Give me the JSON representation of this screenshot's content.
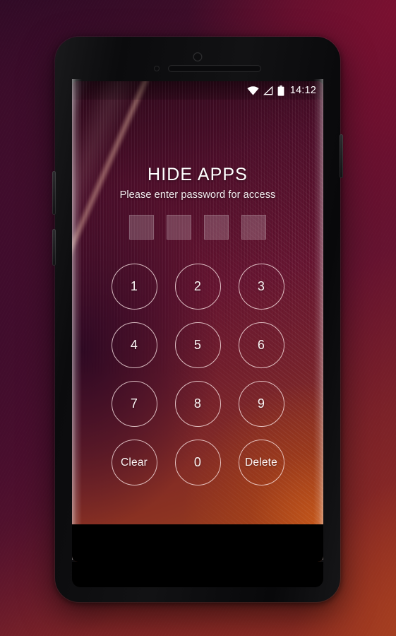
{
  "device": {
    "name": "android-smartphone-mockup",
    "hardware": {
      "front_camera": "camera-icon",
      "proximity_sensor": "sensor-icon",
      "earpiece": "speaker-grille-icon",
      "buttons": [
        "volume-button",
        "bixby-button",
        "power-button"
      ]
    }
  },
  "statusbar": {
    "wifi_icon": "wifi-icon",
    "signal_icon": "signal-triangle-icon",
    "battery_icon": "battery-full-icon",
    "time": "14:12"
  },
  "lockscreen": {
    "title": "HIDE APPS",
    "subtitle": "Please enter password for access",
    "pin_boxes": [
      "",
      "",
      "",
      ""
    ],
    "keypad": [
      {
        "label": "1",
        "type": "digit"
      },
      {
        "label": "2",
        "type": "digit"
      },
      {
        "label": "3",
        "type": "digit"
      },
      {
        "label": "4",
        "type": "digit"
      },
      {
        "label": "5",
        "type": "digit"
      },
      {
        "label": "6",
        "type": "digit"
      },
      {
        "label": "7",
        "type": "digit"
      },
      {
        "label": "8",
        "type": "digit"
      },
      {
        "label": "9",
        "type": "digit"
      },
      {
        "label": "Clear",
        "type": "action"
      },
      {
        "label": "0",
        "type": "digit"
      },
      {
        "label": "Delete",
        "type": "action"
      }
    ]
  },
  "colors": {
    "backdrop_top_left": "#2e0a25",
    "backdrop_top_right": "#6b0f2a",
    "backdrop_bottom_right": "#963021",
    "wallpaper_dark": "#2b0819",
    "wallpaper_mid": "#651430",
    "wallpaper_warm": "#a2471b",
    "key_outline": "#ffebeb",
    "text_primary": "#ffffff"
  }
}
